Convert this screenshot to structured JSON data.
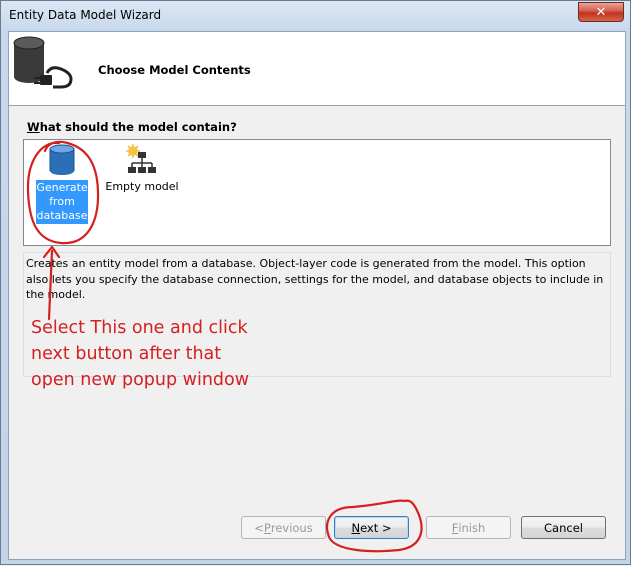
{
  "window": {
    "title": "Entity Data Model Wizard",
    "close_glyph": "✕"
  },
  "header": {
    "title": "Choose Model Contents",
    "icon": "database-plug-icon"
  },
  "question": {
    "accel": "W",
    "rest": "hat should the model contain?"
  },
  "options": [
    {
      "label_lines": [
        "Generate",
        "from",
        "database"
      ],
      "icon": "database-icon",
      "selected": true
    },
    {
      "label": "Empty model",
      "icon": "empty-model-icon",
      "selected": false
    }
  ],
  "description": "Creates an entity model from a database. Object-layer code is generated from the model. This option also lets you specify the database connection, settings for the model, and database objects to include in the model.",
  "annotation_lines": [
    "Select This one and click",
    "next button after that",
    "open new popup window"
  ],
  "buttons": {
    "previous": {
      "pre": "< ",
      "accel": "P",
      "rest": "revious"
    },
    "next": {
      "accel": "N",
      "rest": "ext >"
    },
    "finish": {
      "accel": "F",
      "rest": "inish"
    },
    "cancel": "Cancel"
  },
  "colors": {
    "selection": "#3399ff",
    "annotation": "#d42020"
  }
}
